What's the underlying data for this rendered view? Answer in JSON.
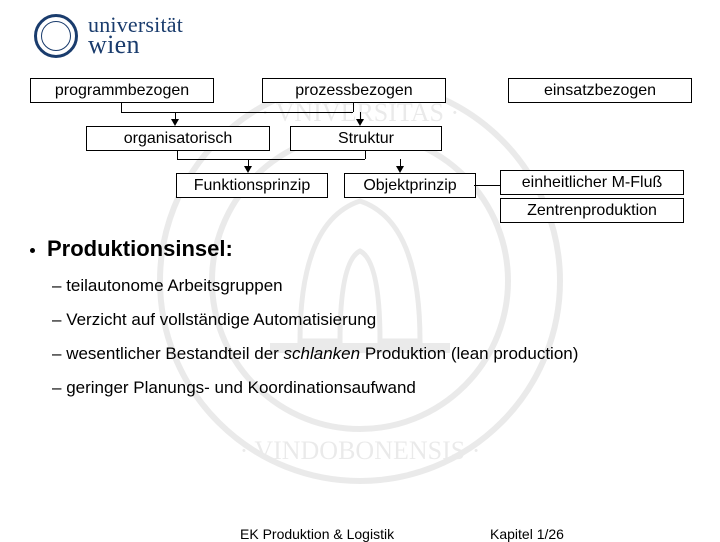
{
  "logo": {
    "line1": "universität",
    "line2": "wien"
  },
  "diagram": {
    "row1": {
      "a": "programmbezogen",
      "b": "prozessbezogen",
      "c": "einsatzbezogen"
    },
    "row2": {
      "a": "organisatorisch",
      "b": "Struktur"
    },
    "row3": {
      "a": "Funktionsprinzip",
      "b": "Objektprinzip",
      "c": "einheitlicher M-Fluß",
      "d": "Zentrenproduktion"
    }
  },
  "heading": "Produktionsinsel:",
  "bullets": {
    "b0": "teilautonome Arbeitsgruppen",
    "b1": "Verzicht auf vollständige Automatisierung",
    "b2_pre": "wesentlicher Bestandteil der ",
    "b2_em": "schlanken",
    "b2_post": " Produktion (lean production)",
    "b3": "geringer Planungs- und Koordinationsaufwand"
  },
  "footer": {
    "left": "EK Produktion & Logistik",
    "right": "Kapitel 1/26"
  }
}
